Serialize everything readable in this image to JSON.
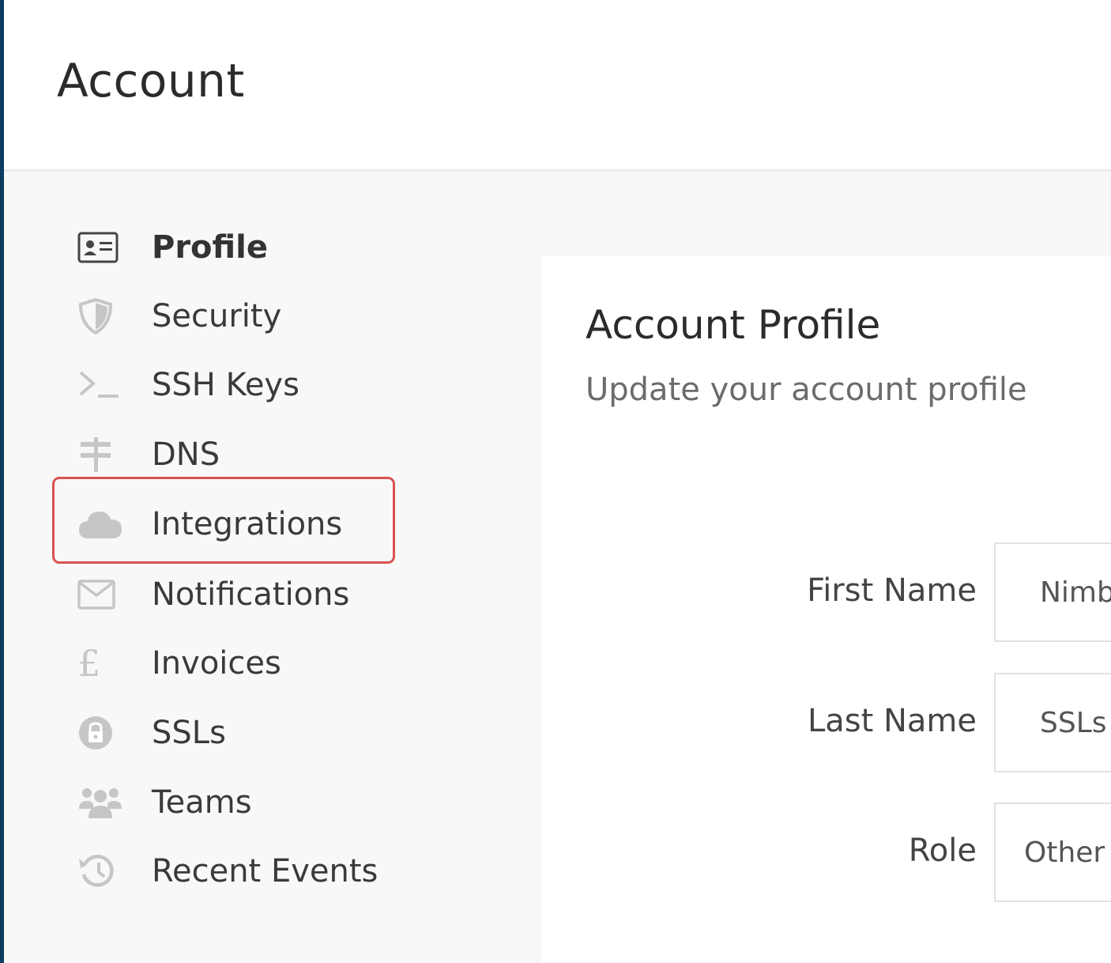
{
  "header": {
    "title": "Account"
  },
  "sidebar": {
    "items": [
      {
        "label": "Profile",
        "icon": "id-card-icon",
        "active": true
      },
      {
        "label": "Security",
        "icon": "shield-icon"
      },
      {
        "label": "SSH Keys",
        "icon": "terminal-icon"
      },
      {
        "label": "DNS",
        "icon": "signpost-icon"
      },
      {
        "label": "Integrations",
        "icon": "cloud-icon",
        "highlighted": true
      },
      {
        "label": "Notifications",
        "icon": "envelope-icon"
      },
      {
        "label": "Invoices",
        "icon": "pound-icon"
      },
      {
        "label": "SSLs",
        "icon": "lock-icon"
      },
      {
        "label": "Teams",
        "icon": "users-icon"
      },
      {
        "label": "Recent Events",
        "icon": "history-icon"
      }
    ]
  },
  "panel": {
    "title": "Account Profile",
    "subtitle": "Update your account profile",
    "fields": {
      "first_name": {
        "label": "First Name",
        "value": "Nimb"
      },
      "last_name": {
        "label": "Last Name",
        "value": "SSLs"
      },
      "role": {
        "label": "Role",
        "value": "Other"
      }
    }
  },
  "colors": {
    "highlight": "#d9534f",
    "accent_edge": "#0d3b5e"
  }
}
